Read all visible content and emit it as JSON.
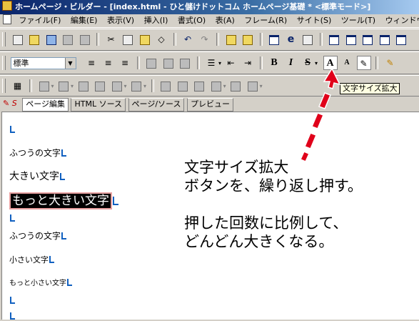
{
  "window": {
    "title": "ホームページ・ビルダー - [index.html - ひと儲けドットコム ホームページ基礎 * <標準モード>]"
  },
  "menu": [
    "ファイル(F)",
    "編集(E)",
    "表示(V)",
    "挿入(I)",
    "書式(O)",
    "表(A)",
    "フレーム(R)",
    "サイト(S)",
    "ツール(T)",
    "ウィンドウ(W)"
  ],
  "format_toolbar": {
    "style_select": "標準",
    "bold": "B",
    "italic": "I",
    "strike": "S",
    "font_up": "A",
    "font_down": "A"
  },
  "tooltip": "文字サイズ拡大",
  "tabs": [
    "ページ編集",
    "HTML ソース",
    "ページ/ソース",
    "プレビュー"
  ],
  "editor": {
    "lines": [
      "ふつうの文字",
      "大きい文字",
      "もっと大きい文字",
      "ふつうの文字",
      "小さい文字",
      "もっと小さい文字"
    ]
  },
  "annotation": {
    "p1_l1": "文字サイズ拡大",
    "p1_l2": "ボタンを、繰り返し押す。",
    "p2_l1": "押した回数に比例して、",
    "p2_l2": "どんどん大きくなる。"
  },
  "colors": {
    "title_bar": "#0a246a",
    "arrow": "#e0001a",
    "selection": "#000000"
  }
}
